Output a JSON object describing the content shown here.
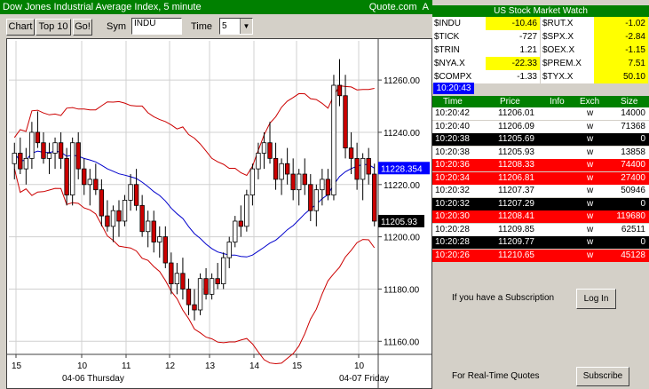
{
  "chart_header": {
    "title": "Dow Jones Industrial Average Index, 5 minute",
    "source": "Quote.com",
    "corner": "A"
  },
  "toolbar": {
    "chart": "Chart",
    "top10": "Top 10",
    "go": "Go!",
    "sym_label": "Sym",
    "sym_value": "INDU",
    "time_label": "Time",
    "time_value": "5"
  },
  "watch": {
    "title": "US Stock Market Watch",
    "rows": [
      {
        "left_name": "$INDU",
        "left_val": "-10.46",
        "right_name": "$RUT.X",
        "right_val": "-1.02"
      },
      {
        "left_name": "$TICK",
        "left_val": "-727",
        "right_name": "$SPX.X",
        "right_val": "-2.84"
      },
      {
        "left_name": "$TRIN",
        "left_val": "1.21",
        "right_name": "$OEX.X",
        "right_val": "-1.15"
      },
      {
        "left_name": "$NYA.X",
        "left_val": "-22.33",
        "right_name": "$PREM.X",
        "right_val": "7.51"
      },
      {
        "left_name": "$COMPX",
        "left_val": "-1.33",
        "right_name": "$TYX.X",
        "right_val": "50.10"
      }
    ]
  },
  "clock": "10:20:43",
  "trades": {
    "headers": {
      "time": "Time",
      "price": "Price",
      "info": "Info",
      "exch": "Exch",
      "size": "Size"
    },
    "rows": [
      {
        "time": "10:20:42",
        "price": "11206.01",
        "exch": "w",
        "size": "14000",
        "style": "w"
      },
      {
        "time": "10:20:40",
        "price": "11206.09",
        "exch": "w",
        "size": "71368",
        "style": "w"
      },
      {
        "time": "10:20:38",
        "price": "11205.69",
        "exch": "w",
        "size": "0",
        "style": "b"
      },
      {
        "time": "10:20:38",
        "price": "11205.93",
        "exch": "w",
        "size": "13858",
        "style": "w"
      },
      {
        "time": "10:20:36",
        "price": "11208.33",
        "exch": "w",
        "size": "74400",
        "style": "r"
      },
      {
        "time": "10:20:34",
        "price": "11206.81",
        "exch": "w",
        "size": "27400",
        "style": "r"
      },
      {
        "time": "10:20:32",
        "price": "11207.37",
        "exch": "w",
        "size": "50946",
        "style": "w"
      },
      {
        "time": "10:20:32",
        "price": "11207.29",
        "exch": "w",
        "size": "0",
        "style": "b"
      },
      {
        "time": "10:20:30",
        "price": "11208.41",
        "exch": "w",
        "size": "119680",
        "style": "r"
      },
      {
        "time": "10:20:28",
        "price": "11209.85",
        "exch": "w",
        "size": "62511",
        "style": "w"
      },
      {
        "time": "10:20:28",
        "price": "11209.77",
        "exch": "w",
        "size": "0",
        "style": "b"
      },
      {
        "time": "10:20:26",
        "price": "11210.65",
        "exch": "w",
        "size": "45128",
        "style": "r"
      }
    ]
  },
  "subscription": {
    "text": "If you have a Subscription",
    "login": "Log In",
    "rt_text": "For Real-Time Quotes",
    "subscribe": "Subscribe"
  },
  "chart_data": {
    "type": "candlestick",
    "y_ticks": [
      "11260.00",
      "11240.00",
      "11220.00",
      "11200.00",
      "11180.00",
      "11160.00"
    ],
    "y_tick_values": [
      11260,
      11240,
      11220,
      11200,
      11180,
      11160
    ],
    "ylim": [
      11155,
      11275
    ],
    "x_ticks": [
      "15",
      "10",
      "11",
      "12",
      "13",
      "14",
      "15",
      "10"
    ],
    "x_tick_hours": [
      15,
      10,
      11,
      12,
      13,
      14,
      15,
      10
    ],
    "date_labels": [
      "04-06 Thursday",
      "04-07 Friday"
    ],
    "ma_label": "11228.354",
    "last_label": "11205.93",
    "colors": {
      "up": "#ffffff",
      "down": "#cc0000",
      "bands": "#cc0000",
      "ma": "#0000cc",
      "ma_label_bg": "#0000ff",
      "last_label_bg": "#000000"
    },
    "candles": [
      [
        11228,
        11236,
        11222,
        11232
      ],
      [
        11232,
        11238,
        11224,
        11226
      ],
      [
        11226,
        11234,
        11220,
        11230
      ],
      [
        11230,
        11244,
        11226,
        11240
      ],
      [
        11240,
        11248,
        11234,
        11236
      ],
      [
        11236,
        11240,
        11228,
        11230
      ],
      [
        11230,
        11236,
        11224,
        11232
      ],
      [
        11232,
        11238,
        11226,
        11236
      ],
      [
        11236,
        11240,
        11226,
        11230
      ],
      [
        11230,
        11234,
        11212,
        11216
      ],
      [
        11216,
        11238,
        11212,
        11236
      ],
      [
        11236,
        11240,
        11222,
        11226
      ],
      [
        11226,
        11230,
        11216,
        11220
      ],
      [
        11220,
        11226,
        11212,
        11222
      ],
      [
        11222,
        11228,
        11216,
        11218
      ],
      [
        11218,
        11222,
        11204,
        11208
      ],
      [
        11208,
        11214,
        11202,
        11204
      ],
      [
        11204,
        11212,
        11198,
        11210
      ],
      [
        11210,
        11214,
        11200,
        11206
      ],
      [
        11206,
        11216,
        11204,
        11214
      ],
      [
        11214,
        11224,
        11210,
        11220
      ],
      [
        11220,
        11226,
        11210,
        11212
      ],
      [
        11212,
        11216,
        11200,
        11202
      ],
      [
        11202,
        11210,
        11196,
        11206
      ],
      [
        11206,
        11210,
        11194,
        11198
      ],
      [
        11198,
        11204,
        11192,
        11200
      ],
      [
        11200,
        11204,
        11188,
        11190
      ],
      [
        11190,
        11194,
        11178,
        11182
      ],
      [
        11182,
        11190,
        11178,
        11186
      ],
      [
        11186,
        11192,
        11176,
        11180
      ],
      [
        11180,
        11184,
        11170,
        11174
      ],
      [
        11174,
        11180,
        11168,
        11172
      ],
      [
        11172,
        11186,
        11170,
        11184
      ],
      [
        11184,
        11188,
        11176,
        11178
      ],
      [
        11178,
        11186,
        11176,
        11184
      ],
      [
        11184,
        11190,
        11180,
        11182
      ],
      [
        11182,
        11194,
        11180,
        11192
      ],
      [
        11192,
        11200,
        11188,
        11198
      ],
      [
        11198,
        11208,
        11196,
        11206
      ],
      [
        11206,
        11212,
        11200,
        11204
      ],
      [
        11204,
        11218,
        11202,
        11216
      ],
      [
        11216,
        11228,
        11212,
        11226
      ],
      [
        11226,
        11236,
        11222,
        11232
      ],
      [
        11232,
        11240,
        11226,
        11236
      ],
      [
        11236,
        11244,
        11228,
        11230
      ],
      [
        11230,
        11236,
        11218,
        11222
      ],
      [
        11222,
        11230,
        11216,
        11228
      ],
      [
        11228,
        11234,
        11220,
        11224
      ],
      [
        11224,
        11230,
        11214,
        11218
      ],
      [
        11218,
        11226,
        11212,
        11224
      ],
      [
        11224,
        11230,
        11216,
        11220
      ],
      [
        11220,
        11224,
        11206,
        11210
      ],
      [
        11210,
        11220,
        11204,
        11218
      ],
      [
        11218,
        11226,
        11212,
        11222
      ],
      [
        11222,
        11226,
        11214,
        11216
      ],
      [
        11216,
        11262,
        11214,
        11258
      ],
      [
        11258,
        11268,
        11250,
        11254
      ],
      [
        11254,
        11262,
        11230,
        11234
      ],
      [
        11234,
        11240,
        11224,
        11230
      ],
      [
        11230,
        11236,
        11218,
        11222
      ],
      [
        11222,
        11232,
        11214,
        11230
      ],
      [
        11230,
        11234,
        11220,
        11224
      ],
      [
        11224,
        11228,
        11204,
        11206
      ]
    ]
  }
}
